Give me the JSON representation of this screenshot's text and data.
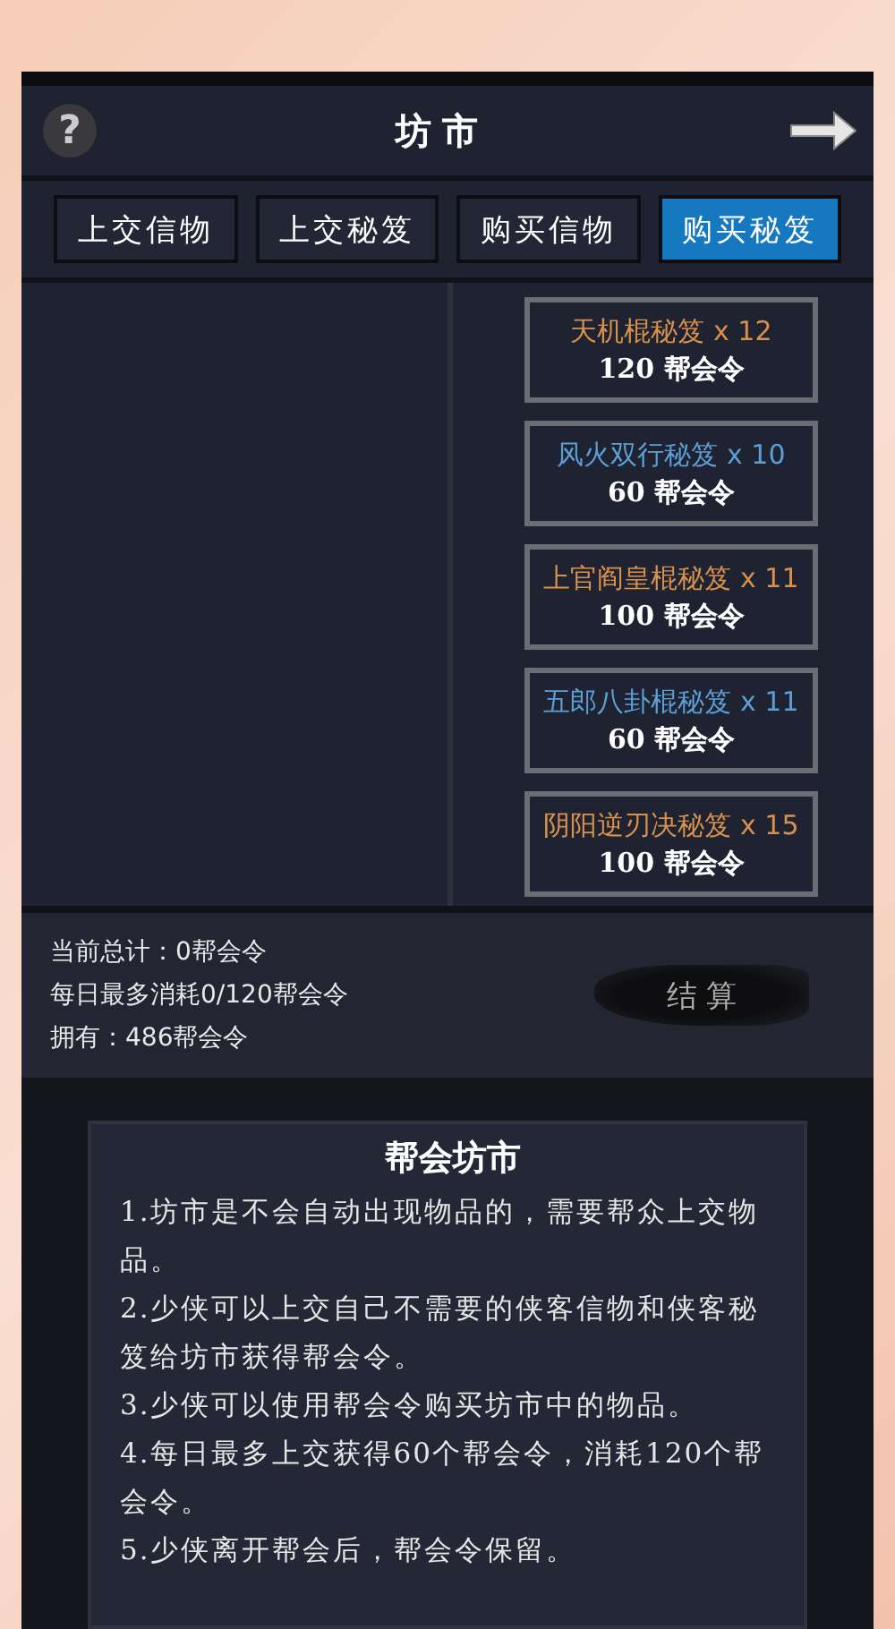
{
  "header": {
    "title": "坊市",
    "help": "?"
  },
  "tabs": [
    {
      "label": "上交信物",
      "selected": false
    },
    {
      "label": "上交秘笈",
      "selected": false
    },
    {
      "label": "购买信物",
      "selected": false
    },
    {
      "label": "购买秘笈",
      "selected": true
    }
  ],
  "items": [
    {
      "name": "天机棍秘笈",
      "count": "x 12",
      "price": "120 帮会令",
      "color": "#d8914c"
    },
    {
      "name": "风火双行秘笈",
      "count": "x 10",
      "price": "60 帮会令",
      "color": "#5b9fd6"
    },
    {
      "name": "上官阎皇棍秘笈",
      "count": "x 11",
      "price": "100 帮会令",
      "color": "#d8914c"
    },
    {
      "name": "五郎八卦棍秘笈",
      "count": "x 11",
      "price": "60 帮会令",
      "color": "#5b9fd6"
    },
    {
      "name": "阴阳逆刃决秘笈",
      "count": "x 15",
      "price": "100 帮会令",
      "color": "#d8914c"
    }
  ],
  "summary": [
    "当前总计：0帮会令",
    "每日最多消耗0/120帮会令",
    "拥有：486帮会令"
  ],
  "settle_button": "结 算",
  "dialog": {
    "title": "帮会坊市",
    "paragraphs": [
      "1.坊市是不会自动出现物品的，需要帮众上交物品。",
      "2.少侠可以上交自己不需要的侠客信物和侠客秘笈给坊市获得帮会令。",
      "3.少侠可以使用帮会令购买坊市中的物品。",
      "4.每日最多上交获得60个帮会令，消耗120个帮会令。",
      "5.少侠离开帮会后，帮会令保留。"
    ]
  }
}
